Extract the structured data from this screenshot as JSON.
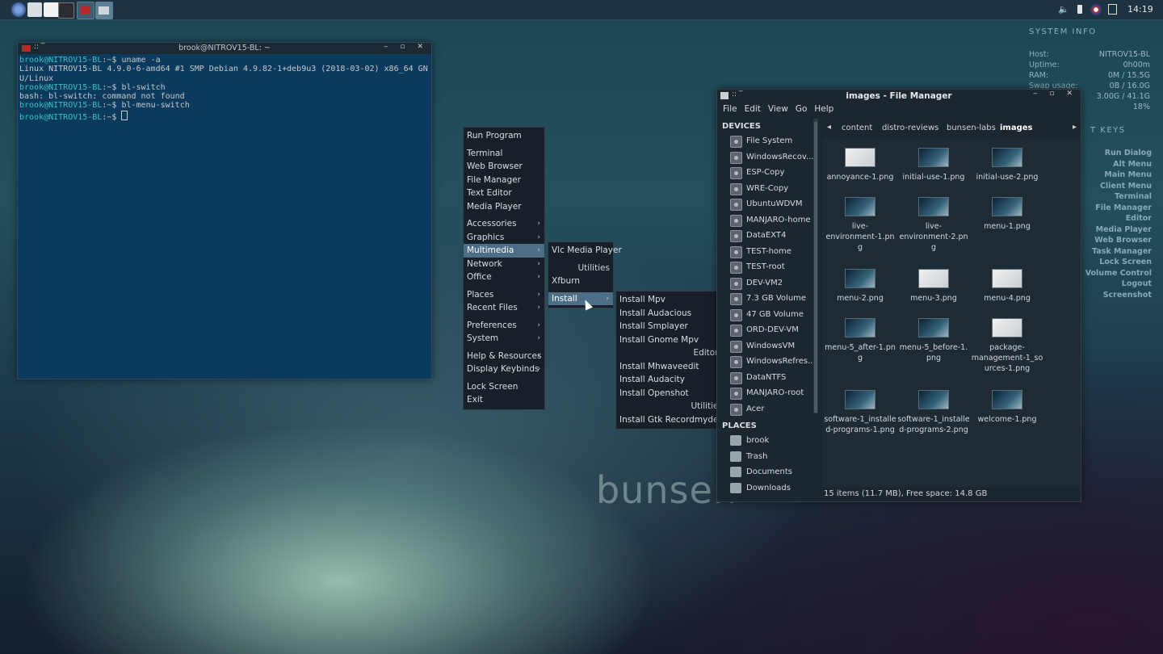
{
  "taskbar": {
    "clock": "14:19"
  },
  "terminal": {
    "title": "brook@NITROV15-BL: ~",
    "lines": [
      {
        "prompt": "brook@NITROV15-BL",
        "rest": ":~$ uname -a"
      },
      {
        "prompt": "",
        "rest": "Linux NITROV15-BL 4.9.0-6-amd64 #1 SMP Debian 4.9.82-1+deb9u3 (2018-03-02) x86_64 GN"
      },
      {
        "prompt": "",
        "rest": "U/Linux"
      },
      {
        "prompt": "brook@NITROV15-BL",
        "rest": ":~$ bl-switch"
      },
      {
        "prompt": "",
        "rest": "bash: bl-switch: command not found"
      },
      {
        "prompt": "brook@NITROV15-BL",
        "rest": ":~$ bl-menu-switch"
      },
      {
        "prompt": "brook@NITROV15-BL",
        "rest": ":~$ "
      }
    ]
  },
  "conky": {
    "system_info_title": "SYSTEM INFO",
    "rows": [
      {
        "k": "Host:",
        "v": "NITROV15-BL"
      },
      {
        "k": "Uptime:",
        "v": "0h00m"
      },
      {
        "k": "RAM:",
        "v": "0M / 15.5G"
      },
      {
        "k": "Swap usage:",
        "v": "0B / 16.0G"
      },
      {
        "k": "",
        "v": "3.00G / 41.1G"
      },
      {
        "k": "",
        "v": "18%"
      }
    ],
    "keys_title": "T KEYS",
    "keys": [
      "Run Dialog",
      "Alt Menu",
      "Main Menu",
      "Client Menu",
      "Terminal",
      "File Manager",
      "Editor",
      "Media Player",
      "Web Browser",
      "Task Manager",
      "Lock Screen",
      "Volume Control",
      "Logout",
      "Screenshot"
    ]
  },
  "watermark": "bunsen",
  "menu_root": {
    "items": [
      {
        "label": "Run Program",
        "arrow": ""
      },
      {
        "label": "Terminal",
        "arrow": "",
        "sep": true
      },
      {
        "label": "Web Browser",
        "arrow": ""
      },
      {
        "label": "File Manager",
        "arrow": ""
      },
      {
        "label": "Text Editor",
        "arrow": ""
      },
      {
        "label": "Media Player",
        "arrow": ""
      },
      {
        "label": "Accessories",
        "arrow": "›",
        "sep": true
      },
      {
        "label": "Graphics",
        "arrow": "›"
      },
      {
        "label": "Multimedia",
        "arrow": "›",
        "hl": true
      },
      {
        "label": "Network",
        "arrow": "›"
      },
      {
        "label": "Office",
        "arrow": "›"
      },
      {
        "label": "Places",
        "arrow": "›",
        "sep": true
      },
      {
        "label": "Recent Files",
        "arrow": "›"
      },
      {
        "label": "Preferences",
        "arrow": "›",
        "sep": true
      },
      {
        "label": "System",
        "arrow": "›"
      },
      {
        "label": "Help & Resources",
        "arrow": "›",
        "sep": true
      },
      {
        "label": "Display Keybinds",
        "arrow": "›"
      },
      {
        "label": "Lock Screen",
        "arrow": "",
        "sep": true
      },
      {
        "label": "Exit",
        "arrow": ""
      }
    ]
  },
  "menu_multimedia": {
    "items": [
      {
        "label": "Vlc Media Player",
        "arrow": ""
      },
      {
        "label": "Utilities",
        "hdr": true,
        "sep": true
      },
      {
        "label": "Xfburn",
        "arrow": ""
      },
      {
        "label": "Install",
        "arrow": "›",
        "hl": true,
        "sep": true
      }
    ]
  },
  "menu_install": {
    "items": [
      {
        "label": "Install Mpv"
      },
      {
        "label": "Install Audacious"
      },
      {
        "label": "Install Smplayer"
      },
      {
        "label": "Install Gnome Mpv"
      },
      {
        "label": "Editors",
        "hdr": true
      },
      {
        "label": "Install Mhwaveedit"
      },
      {
        "label": "Install Audacity"
      },
      {
        "label": "Install Openshot"
      },
      {
        "label": "Utilities",
        "hdr": true
      },
      {
        "label": "Install Gtk Recordmydesktop"
      }
    ]
  },
  "file_manager": {
    "title": "images - File Manager",
    "menubar": [
      "File",
      "Edit",
      "View",
      "Go",
      "Help"
    ],
    "devices_header": "DEVICES",
    "devices": [
      "File System",
      "WindowsRecov...",
      "ESP-Copy",
      "WRE-Copy",
      "UbuntuWDVM",
      "MANJARO-home",
      "DataEXT4",
      "TEST-home",
      "TEST-root",
      "DEV-VM2",
      "7.3 GB Volume",
      "47 GB Volume",
      "ORD-DEV-VM",
      "WindowsVM",
      "WindowsRefres...",
      "DataNTFS",
      "MANJARO-root",
      "Acer"
    ],
    "places_header": "PLACES",
    "places": [
      "brook",
      "Trash",
      "Documents",
      "Downloads"
    ],
    "breadcrumbs": [
      "content",
      "distro-reviews",
      "bunsen-labs",
      "images"
    ],
    "files": [
      {
        "name": [
          "annoyance-1.png"
        ],
        "white": true
      },
      {
        "name": [
          "initial-use-1.png"
        ]
      },
      {
        "name": [
          "initial-use-2.png"
        ]
      },
      {
        "name": [
          "live-",
          "environment-1.pn",
          "g"
        ]
      },
      {
        "name": [
          "live-",
          "environment-2.pn",
          "g"
        ]
      },
      {
        "name": [
          "menu-1.png"
        ]
      },
      {
        "name": [
          "menu-2.png"
        ]
      },
      {
        "name": [
          "menu-3.png"
        ],
        "white": true
      },
      {
        "name": [
          "menu-4.png"
        ],
        "white": true
      },
      {
        "name": [
          "menu-5_after-1.pn",
          "g"
        ]
      },
      {
        "name": [
          "menu-5_before-1.",
          "png"
        ]
      },
      {
        "name": [
          "package-",
          "management-1_so",
          "urces-1.png"
        ],
        "white": true
      },
      {
        "name": [
          "software-1_installe",
          "d-programs-1.png"
        ]
      },
      {
        "name": [
          "software-1_installe",
          "d-programs-2.png"
        ]
      },
      {
        "name": [
          "welcome-1.png"
        ]
      }
    ],
    "status": "15 items (11.7 MB), Free space: 14.8 GB"
  }
}
